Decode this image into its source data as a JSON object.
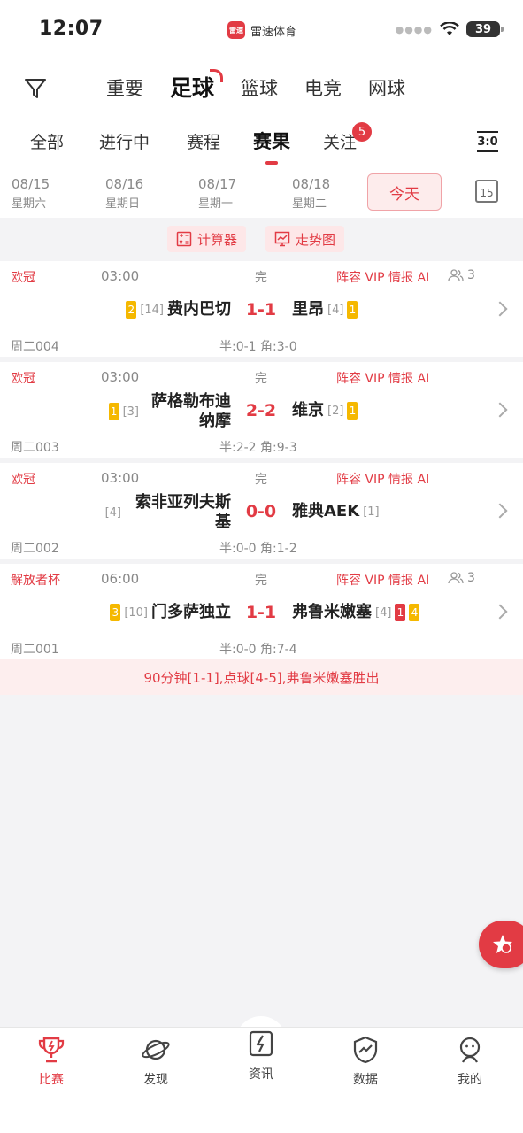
{
  "status_bar": {
    "time": "12:07",
    "app_name": "雷速体育",
    "app_logo_text": "雷速",
    "battery": "39"
  },
  "sport_tabs": [
    {
      "label": "重要"
    },
    {
      "label": "足球",
      "active": true
    },
    {
      "label": "篮球"
    },
    {
      "label": "电竞"
    },
    {
      "label": "网球"
    }
  ],
  "sub_tabs": [
    {
      "label": "全部"
    },
    {
      "label": "进行中"
    },
    {
      "label": "赛程"
    },
    {
      "label": "赛果",
      "active": true
    },
    {
      "label": "关注",
      "badge": "5"
    }
  ],
  "score_toggle_label": "3:0",
  "dates": [
    {
      "date": "08/15",
      "weekday": "星期六"
    },
    {
      "date": "08/16",
      "weekday": "星期日"
    },
    {
      "date": "08/17",
      "weekday": "星期一"
    },
    {
      "date": "08/18",
      "weekday": "星期二"
    }
  ],
  "today_label": "今天",
  "calendar_label": "15",
  "tools": {
    "calculator": "计算器",
    "trend": "走势图"
  },
  "matches": [
    {
      "league": "欧冠",
      "time": "03:00",
      "status": "完",
      "links": "阵容 VIP 情报 AI",
      "fans": "3",
      "home": {
        "card": "2",
        "rank": "[14]",
        "name": "费内巴切"
      },
      "score": "1-1",
      "away": {
        "name": "里昂",
        "rank": "[4]",
        "card": "1"
      },
      "code": "周二004",
      "half": "半:0-1 角:3-0"
    },
    {
      "league": "欧冠",
      "time": "03:00",
      "status": "完",
      "links": "阵容 VIP 情报 AI",
      "home": {
        "card": "1",
        "rank": "[3]",
        "name_line1": "萨格勒布迪",
        "name_line2": "纳摩"
      },
      "score": "2-2",
      "away": {
        "name": "维京",
        "rank": "[2]",
        "card": "1"
      },
      "code": "周二003",
      "half": "半:2-2 角:9-3"
    },
    {
      "league": "欧冠",
      "time": "03:00",
      "status": "完",
      "links": "阵容 VIP 情报 AI",
      "home": {
        "rank": "[4]",
        "name_line1": "索非亚列夫斯",
        "name_line2": "基"
      },
      "score": "0-0",
      "away": {
        "name": "雅典AEK",
        "rank": "[1]"
      },
      "code": "周二002",
      "half": "半:0-0 角:1-2"
    },
    {
      "league": "解放者杯",
      "time": "06:00",
      "status": "完",
      "links": "阵容 VIP 情报 AI",
      "fans": "3",
      "home": {
        "card": "3",
        "rank": "[10]",
        "name": "门多萨独立"
      },
      "score": "1-1",
      "away": {
        "name": "弗鲁米嫩塞",
        "rank": "[4]",
        "red_card": "1",
        "card": "4"
      },
      "code": "周二001",
      "half": "半:0-0 角:7-4",
      "note": "90分钟[1-1],点球[4-5],弗鲁米嫩塞胜出"
    }
  ],
  "bottom_nav": [
    {
      "label": "比赛",
      "icon": "trophy-icon",
      "active": true
    },
    {
      "label": "发现",
      "icon": "planet-icon"
    },
    {
      "label": "资讯",
      "icon": "lightning-icon"
    },
    {
      "label": "数据",
      "icon": "chart-shield-icon"
    },
    {
      "label": "我的",
      "icon": "user-icon"
    }
  ],
  "colors": {
    "accent": "#e23b44",
    "card_yellow": "#f5b800",
    "muted": "#888888"
  }
}
